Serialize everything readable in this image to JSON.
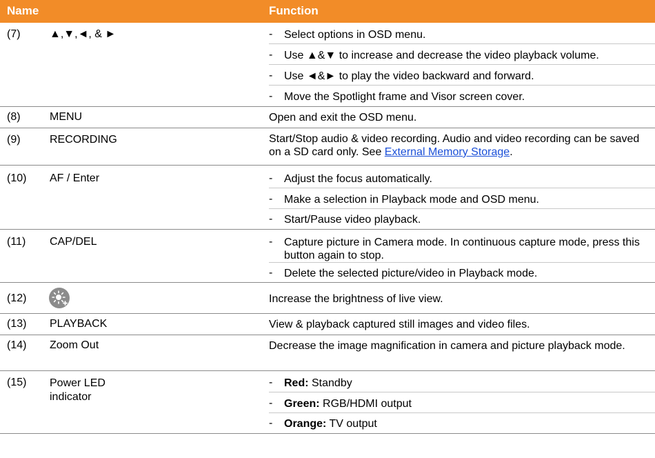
{
  "header": {
    "name_label": "Name",
    "function_label": "Function"
  },
  "rows": [
    {
      "num": "(7)",
      "name": "▲,▼,◄, & ►",
      "items": [
        "Select options in OSD menu.",
        "Use ▲&▼ to increase and decrease the video playback volume.",
        "Use ◄&► to play the video backward and forward.",
        "Move the Spotlight frame and Visor screen cover."
      ]
    },
    {
      "num": "(8)",
      "name": "MENU",
      "text": "Open and exit the OSD menu."
    },
    {
      "num": "(9)",
      "name": "RECORDING",
      "text": "Start/Stop audio & video recording. Audio and video recording can be saved on a SD card only. See ",
      "link": "External Memory Storage",
      "text_after": "."
    },
    {
      "num": "(10)",
      "name": "AF / Enter",
      "items": [
        "Adjust the focus automatically.",
        "Make a selection in Playback mode and OSD menu.",
        "Start/Pause video playback."
      ]
    },
    {
      "num": "(11)",
      "name": "CAP/DEL",
      "items": [
        "Capture picture in Camera mode. In continuous capture mode, press this button again to stop.",
        "Delete the selected picture/video in Playback mode."
      ]
    },
    {
      "num": "(12)",
      "icon": "brightness-plus-icon",
      "text": "Increase the brightness of live view."
    },
    {
      "num": "(13)",
      "name": "PLAYBACK",
      "text": "View & playback captured still images and video files."
    },
    {
      "num": "(14)",
      "name": "Zoom Out",
      "text": "Decrease the image magnification in camera and picture playback mode."
    },
    {
      "num": "(15)",
      "name": "Power LED indicator",
      "items": [
        {
          "bold": "Red:",
          "rest": " Standby"
        },
        {
          "bold": "Green:",
          "rest": " RGB/HDMI output"
        },
        {
          "bold": "Orange:",
          "rest": " TV output"
        }
      ]
    }
  ],
  "colors": {
    "header_bg": "#f28c28",
    "link": "#1a4fd8",
    "icon_bg": "#8c8c8c"
  }
}
